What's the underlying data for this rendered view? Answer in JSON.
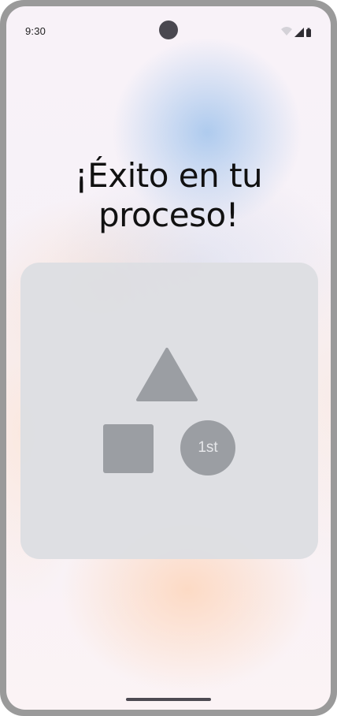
{
  "status_bar": {
    "time": "9:30",
    "icons": [
      "wifi-icon",
      "signal-icon",
      "battery-icon"
    ]
  },
  "main": {
    "title": "¡Éxito en tu proceso!",
    "illustration": {
      "shapes": [
        "triangle",
        "square",
        "circle"
      ],
      "badge_text": "1st"
    }
  },
  "colors": {
    "shape_fill": "#9b9ea3",
    "card_background": "#dddee2",
    "title_text": "#111111"
  }
}
